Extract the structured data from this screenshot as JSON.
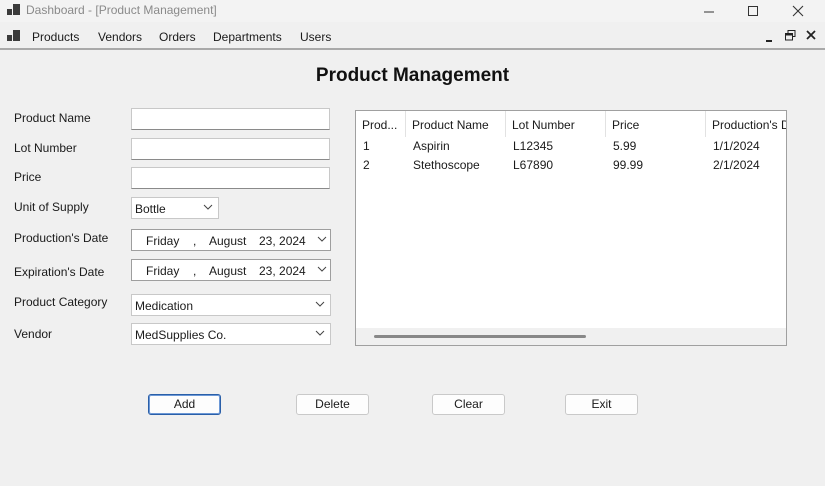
{
  "window": {
    "title": "Dashboard - [Product Management]"
  },
  "menu": {
    "items": [
      "Products",
      "Vendors",
      "Orders",
      "Departments",
      "Users"
    ]
  },
  "page": {
    "title": "Product Management"
  },
  "form": {
    "product_name": {
      "label": "Product Name",
      "value": ""
    },
    "lot_number": {
      "label": "Lot Number",
      "value": ""
    },
    "price": {
      "label": "Price",
      "value": ""
    },
    "unit_of_supply": {
      "label": "Unit of Supply",
      "value": "Bottle"
    },
    "production_date": {
      "label": "Production's Date",
      "day": "Friday",
      "comma": ",",
      "month": "August",
      "date": "23, 2024"
    },
    "expiration_date": {
      "label": "Expiration's Date",
      "day": "Friday",
      "comma": ",",
      "month": "August",
      "date": "23, 2024"
    },
    "product_category": {
      "label": "Product Category",
      "value": "Medication"
    },
    "vendor": {
      "label": "Vendor",
      "value": "MedSupplies Co."
    }
  },
  "grid": {
    "columns": [
      "Prod...",
      "Product Name",
      "Lot Number",
      "Price",
      "Production's D"
    ],
    "rows": [
      [
        "1",
        "Aspirin",
        "L12345",
        "5.99",
        "1/1/2024"
      ],
      [
        "2",
        "Stethoscope",
        "L67890",
        "99.99",
        "2/1/2024"
      ]
    ]
  },
  "buttons": {
    "add": "Add",
    "delete": "Delete",
    "clear": "Clear",
    "exit": "Exit"
  }
}
